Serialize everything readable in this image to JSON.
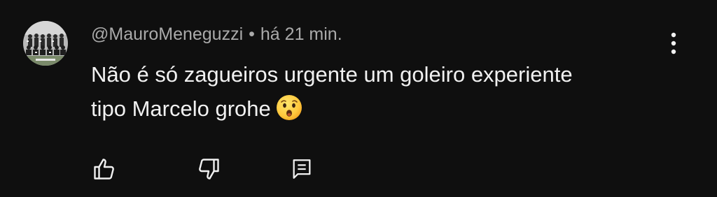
{
  "comment": {
    "author": "@MauroMeneguzzi",
    "separator": "•",
    "time": "há 21 min.",
    "text_lines": [
      "Não é só zagueiros urgente um goleiro experiente",
      "tipo Marcelo grohe"
    ],
    "emoji": "hushed-face-emoji",
    "avatar": "team-photo-avatar"
  },
  "actions": {
    "like_icon": "thumbs-up-icon",
    "dislike_icon": "thumbs-down-icon",
    "reply_icon": "comment-reply-icon"
  },
  "menu_icon": "more-vertical-icon",
  "colors": {
    "background": "#0f0f0f",
    "text": "#f1f1f1",
    "meta": "#aaaaaa"
  }
}
